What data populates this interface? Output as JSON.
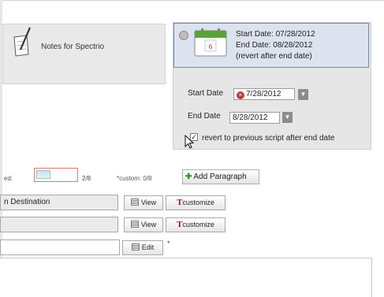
{
  "notes": {
    "label": "Notes for Spectrio"
  },
  "schedule": {
    "header_start": "Start Date: 07/28/2012",
    "header_end": "End Date: 08/28/2012",
    "header_note": "(revert after end date)",
    "start_label": "Start Date",
    "start_value": "7/28/2012",
    "end_label": "End Date",
    "end_value": "8/28/2012",
    "revert_label": "revert to previous script after end date",
    "revert_checked": true
  },
  "paragraphs": {
    "count_label": "ed:",
    "count_value": "2/8",
    "custom_label": "*custom: 0/8",
    "add_button": "Add Paragraph",
    "rows": [
      {
        "field": "n Destination",
        "view": "View",
        "customize": "customize"
      },
      {
        "field": "",
        "view": "View",
        "customize": "customize"
      },
      {
        "field": "",
        "edit": "Edit",
        "mark": "*"
      }
    ]
  },
  "icons": [
    "notepad-pencil-icon",
    "calendar-icon",
    "collapse-icon",
    "clear-date-icon",
    "dropdown-arrow-icon",
    "checkbox-icon",
    "mouse-cursor-icon",
    "plus-icon",
    "list-icon",
    "text-format-icon"
  ],
  "colors": {
    "header_border": "#6f89b4",
    "header_bg": "#dce3ee",
    "panel_bg": "#e6e6e6",
    "clear_red": "#c23b3b",
    "plus_green": "#2f9a2f",
    "meter_border": "#e07a5f"
  }
}
